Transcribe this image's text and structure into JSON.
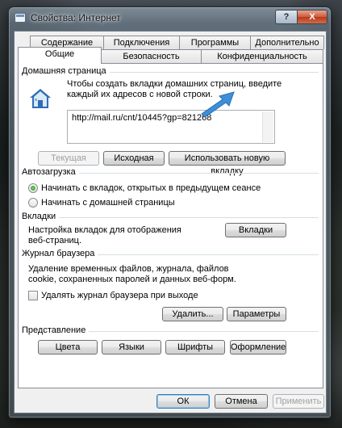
{
  "window": {
    "title": "Свойства: Интернет",
    "help_label": "?",
    "close_label": "X"
  },
  "tabs": {
    "back_row": [
      "Содержание",
      "Подключения",
      "Программы",
      "Дополнительно"
    ],
    "front_row": [
      "Общие",
      "Безопасность",
      "Конфиденциальность"
    ],
    "active": "Общие"
  },
  "homepage": {
    "group_title": "Домашняя страница",
    "description": "Чтобы создать вкладки домашних страниц, введите каждый их адресов с новой строки.",
    "url_value": "http://mail.ru/cnt/10445?gp=821268",
    "btn_current": "Текущая",
    "btn_original": "Исходная",
    "btn_new_tab": "Использовать новую вкладку"
  },
  "startup": {
    "group_title": "Автозагрузка",
    "option_tabs": "Начинать с вкладок, открытых в предыдущем сеансе",
    "option_home": "Начинать с домашней страницы",
    "selected": "option_tabs"
  },
  "tabs_section": {
    "group_title": "Вкладки",
    "description": "Настройка вкладок для отображения веб-страниц.",
    "btn_tabs": "Вкладки"
  },
  "history": {
    "group_title": "Журнал браузера",
    "description": "Удаление временных файлов, журнала, файлов cookie, сохраненных паролей и данных веб-форм.",
    "checkbox_label": "Удалять журнал браузера при выходе",
    "checkbox_checked": false,
    "btn_delete": "Удалить...",
    "btn_settings": "Параметры"
  },
  "appearance": {
    "group_title": "Представление",
    "btn_colors": "Цвета",
    "btn_languages": "Языки",
    "btn_fonts": "Шрифты",
    "btn_design": "Оформление"
  },
  "footer": {
    "btn_ok": "ОК",
    "btn_cancel": "Отмена",
    "btn_apply": "Применить"
  },
  "colors": {
    "accent_arrow": "#3d8fd9",
    "group_title_text": "#000000"
  }
}
